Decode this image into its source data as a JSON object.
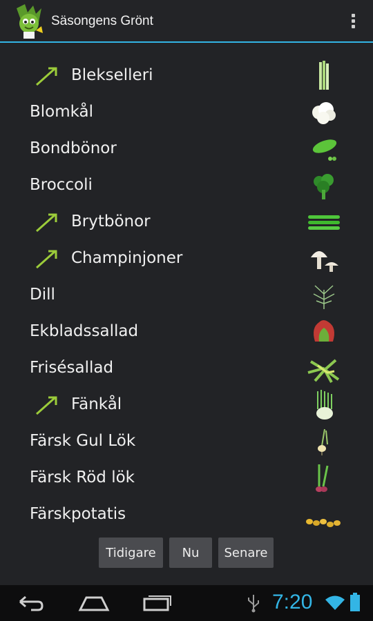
{
  "app": {
    "title": "Säsongens Grönt",
    "accent": "#33b5e5",
    "logo_icon": "leek-character-icon",
    "overflow_icon": "overflow-menu-icon"
  },
  "list": {
    "items": [
      {
        "label": "Blekselleri",
        "trend": true,
        "icon": "celery-icon"
      },
      {
        "label": "Blomkål",
        "trend": false,
        "icon": "cauliflower-icon"
      },
      {
        "label": "Bondbönor",
        "trend": false,
        "icon": "broad-beans-icon"
      },
      {
        "label": "Broccoli",
        "trend": false,
        "icon": "broccoli-icon"
      },
      {
        "label": "Brytbönor",
        "trend": true,
        "icon": "green-beans-icon"
      },
      {
        "label": "Champinjoner",
        "trend": true,
        "icon": "mushroom-icon"
      },
      {
        "label": "Dill",
        "trend": false,
        "icon": "dill-icon"
      },
      {
        "label": "Ekbladssallad",
        "trend": false,
        "icon": "oakleaf-lettuce-icon"
      },
      {
        "label": "Frisésallad",
        "trend": false,
        "icon": "frisee-icon"
      },
      {
        "label": "Fänkål",
        "trend": true,
        "icon": "fennel-icon"
      },
      {
        "label": "Färsk Gul Lök",
        "trend": false,
        "icon": "yellow-onion-icon"
      },
      {
        "label": "Färsk Röd lök",
        "trend": false,
        "icon": "red-onion-icon"
      },
      {
        "label": "Färskpotatis",
        "trend": false,
        "icon": "new-potatoes-icon"
      }
    ]
  },
  "buttons": {
    "earlier": "Tidigare",
    "now": "Nu",
    "later": "Senare"
  },
  "status": {
    "time": "7:20",
    "usb_icon": "usb-icon",
    "wifi_icon": "wifi-icon",
    "battery_icon": "battery-icon"
  },
  "nav": {
    "back_icon": "back-icon",
    "home_icon": "home-icon",
    "recents_icon": "recents-icon"
  }
}
